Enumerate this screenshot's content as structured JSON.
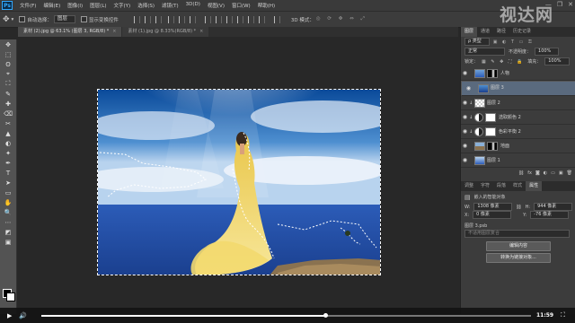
{
  "app": {
    "logo": "Ps"
  },
  "menu": [
    "文件(F)",
    "编辑(E)",
    "图像(I)",
    "图层(L)",
    "文字(Y)",
    "选择(S)",
    "滤镜(T)",
    "3D(D)",
    "视图(V)",
    "窗口(W)",
    "帮助(H)"
  ],
  "window_controls": {
    "minimize": "—",
    "restore": "❐",
    "close": "✕"
  },
  "watermark": "视达网",
  "options": {
    "auto_select_label": "自动选择：",
    "auto_select_value": "图层",
    "show_transform_label": "显示变换控件",
    "mode_3d_label": "3D 模式："
  },
  "tabs": [
    {
      "label": "素材 (2).jpg @ 63.1% (图层 3, RGB/8) *",
      "close": "×",
      "active": true
    },
    {
      "label": "素材 (1).jpg @ 8.33%(RGB/8) *",
      "close": "×",
      "active": false
    }
  ],
  "tools": [
    "✥",
    "⬚",
    "ʘ",
    "⌖",
    "⛶",
    "✎",
    "✚",
    "⌫",
    "✂",
    "▲",
    "◐",
    "✦",
    "✒",
    "T",
    "➤",
    "▭",
    "✋",
    "🔍",
    "⋯",
    "◩",
    "▣"
  ],
  "layers_panel": {
    "tabs": [
      "图层",
      "通道",
      "路径",
      "历史记录"
    ],
    "kind_label": "ρ 类型",
    "blend_mode": "正常",
    "opacity_label": "不透明度：",
    "opacity_value": "100%",
    "lock_label": "锁定：",
    "fill_label": "填充：",
    "fill_value": "100%",
    "layers": [
      {
        "name": "人物",
        "type": "image",
        "selected": false
      },
      {
        "name": "图层 3",
        "type": "smart",
        "selected": true
      },
      {
        "name": "图层 2",
        "type": "trans",
        "selected": false
      },
      {
        "name": "选取颜色 2",
        "type": "adjust",
        "selected": false
      },
      {
        "name": "色彩平衡 2",
        "type": "adjust",
        "selected": false
      },
      {
        "name": "地面",
        "type": "image2",
        "selected": false
      },
      {
        "name": "图层 1",
        "type": "image3",
        "selected": false
      }
    ],
    "footer_icons": [
      "⛓",
      "fx",
      "◙",
      "◐",
      "▭",
      "▣",
      "🗑"
    ]
  },
  "properties_panel": {
    "tabs": [
      "调整",
      "字符",
      "段落",
      "样式",
      "属性"
    ],
    "section_title": "嵌入的智能对象",
    "w_label": "W:",
    "w_value": "1308 像素",
    "h_label": "H:",
    "h_value": "944 像素",
    "x_label": "X:",
    "x_value": "0 像素",
    "y_label": "Y:",
    "y_value": "-76 像素",
    "file_name": "图层 3.psb",
    "comps_placeholder": "不适用图层复合",
    "edit_button": "编辑内容",
    "convert_button": "转换为链接对象..."
  },
  "video": {
    "time": "11:59",
    "progress": 0.58
  }
}
